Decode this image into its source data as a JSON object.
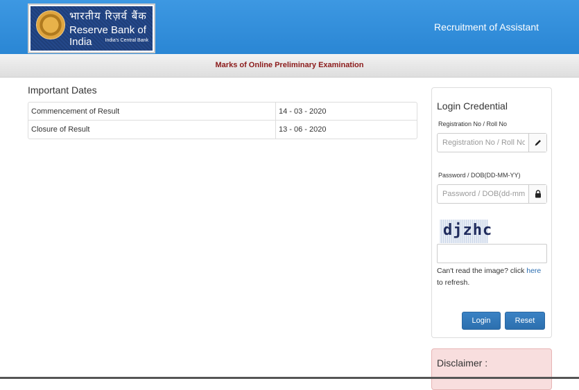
{
  "header": {
    "logo_hindi": "भारतीय रिज़र्व बैंक",
    "logo_english": "Reserve Bank of India",
    "logo_tagline": "India's Central Bank",
    "title": "Recruitment of Assistant"
  },
  "subbar": {
    "title": "Marks of Online Preliminary Examination"
  },
  "important_dates": {
    "heading": "Important Dates",
    "rows": [
      {
        "label": "Commencement of Result",
        "value": "14 - 03 - 2020"
      },
      {
        "label": "Closure of Result",
        "value": "13 - 06 - 2020"
      }
    ]
  },
  "login": {
    "title": "Login Credential",
    "reg_label": "Registration No / Roll No",
    "reg_placeholder": "Registration No / Roll No",
    "reg_icon": "pencil-icon",
    "pwd_label": "Password / DOB(DD-MM-YY)",
    "pwd_placeholder": "Password / DOB(dd-mm-yy)",
    "pwd_icon": "lock-icon",
    "captcha_text": "djzhc",
    "refresh_prefix": "Can't read the image? click ",
    "refresh_link": "here",
    "refresh_suffix": " to refresh.",
    "login_button": "Login",
    "reset_button": "Reset"
  },
  "disclaimer": {
    "title": "Disclaimer :"
  },
  "colors": {
    "header_blue": "#2a86d4",
    "subbar_text": "#8b1a1a",
    "button_blue": "#2c6fae",
    "disclaimer_bg": "#f8dede"
  }
}
